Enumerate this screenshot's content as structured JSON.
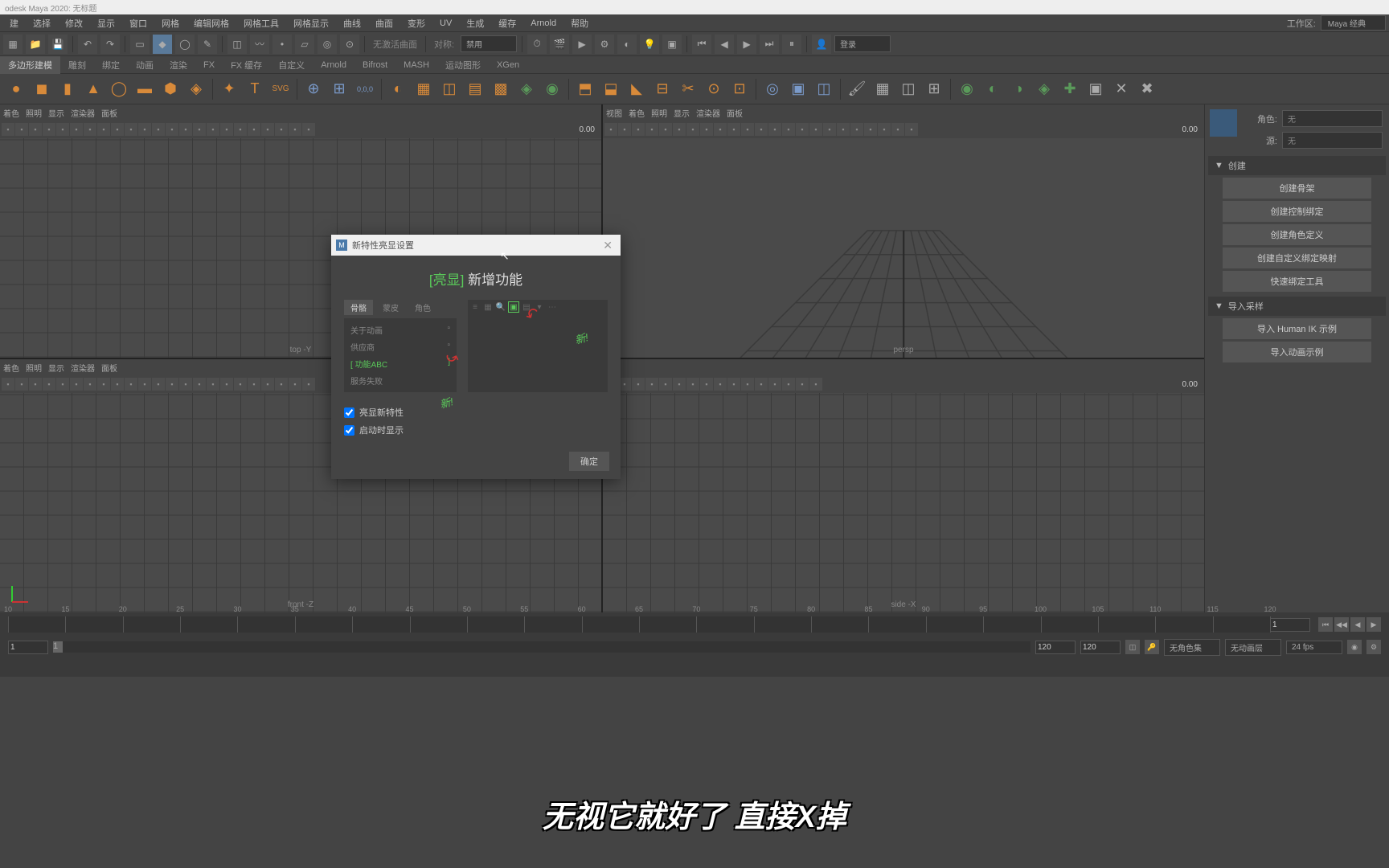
{
  "title": "odesk Maya 2020: 无标题",
  "workspace": {
    "label": "工作区:",
    "value": "Maya 经典"
  },
  "menus": [
    "建",
    "选择",
    "修改",
    "显示",
    "窗口",
    "网格",
    "编辑网格",
    "网格工具",
    "网格显示",
    "曲线",
    "曲面",
    "变形",
    "UV",
    "生成",
    "缓存",
    "Arnold",
    "帮助"
  ],
  "toolbar": {
    "no_active_surface": "无激活曲面",
    "symmetry_label": "对称:",
    "symmetry_value": "禁用",
    "login": "登录"
  },
  "shelf_tabs": [
    "多边形建模",
    "雕刻",
    "绑定",
    "动画",
    "渲染",
    "FX",
    "FX 缓存",
    "自定义",
    "Arnold",
    "Bifrost",
    "MASH",
    "运动图形",
    "XGen"
  ],
  "viewport_menus": [
    "视图",
    "着色",
    "照明",
    "显示",
    "渲染器",
    "面板"
  ],
  "viewport_menus_short": [
    "着色",
    "照明",
    "显示",
    "渲染器",
    "面板"
  ],
  "viewport_labels": {
    "top": "top -Y",
    "persp": "persp",
    "front": "front -Z",
    "side": "side -X"
  },
  "viewport_value": "0.00",
  "right_panel": {
    "role_label": "角色:",
    "role_value": "无",
    "source_label": "源:",
    "source_value": "无",
    "section_create": "创建",
    "buttons_create": [
      "创建骨架",
      "创建控制绑定",
      "创建角色定义",
      "创建自定义绑定映射",
      "快速绑定工具"
    ],
    "section_import": "导入采样",
    "buttons_import": [
      "导入 Human IK 示例",
      "导入动画示例"
    ]
  },
  "timeline": {
    "ticks": [
      10,
      15,
      20,
      25,
      30,
      35,
      40,
      45,
      50,
      55,
      60,
      65,
      70,
      75,
      80,
      85,
      90,
      95,
      100,
      105,
      110,
      115,
      120
    ],
    "current": "1"
  },
  "range": {
    "start": "1",
    "start2": "1",
    "end": "120",
    "end2": "120",
    "nochar": "无角色集",
    "noanim": "无动画层",
    "fps": "24 fps"
  },
  "dialog": {
    "title": "新特性亮显设置",
    "heading_highlight": "[亮显]",
    "heading_rest": " 新增功能",
    "tabs": [
      "骨骼",
      "蒙皮",
      "角色"
    ],
    "list": [
      "关于动画",
      "供应商",
      "功能ABC",
      "服务失败"
    ],
    "list_highlight_idx": 2,
    "new_badge": "新!",
    "check1": "亮显新特性",
    "check2": "启动时显示",
    "ok": "确定"
  },
  "subtitle": "无视它就好了 直接X掉"
}
